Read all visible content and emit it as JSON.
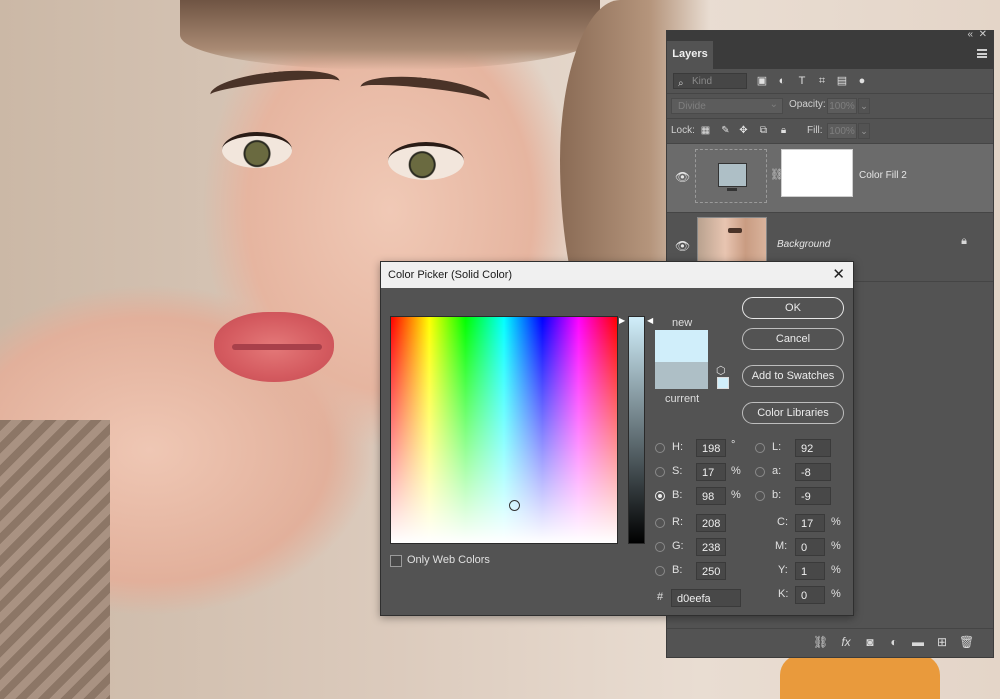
{
  "colors": {
    "new": "#d0eefa",
    "current": "#aebfc6",
    "panel": "#535353"
  },
  "layers_panel": {
    "tab": "Layers",
    "filter_placeholder": "Kind",
    "blend_mode": "Divide",
    "opacity_label": "Opacity:",
    "opacity_value": "100%",
    "lock_label": "Lock:",
    "fill_label": "Fill:",
    "fill_value": "100%",
    "layers": [
      {
        "name": "Color Fill 2",
        "selected": true
      },
      {
        "name": "Background",
        "selected": false
      }
    ]
  },
  "color_picker": {
    "title": "Color Picker (Solid Color)",
    "new_label": "new",
    "current_label": "current",
    "only_web_colors": "Only Web Colors",
    "buttons": {
      "ok": "OK",
      "cancel": "Cancel",
      "add_to_swatches": "Add to Swatches",
      "color_libraries": "Color Libraries"
    },
    "fields": {
      "H": {
        "label": "H:",
        "value": "198",
        "unit": "°"
      },
      "S": {
        "label": "S:",
        "value": "17",
        "unit": "%"
      },
      "B": {
        "label": "B:",
        "value": "98",
        "unit": "%"
      },
      "R": {
        "label": "R:",
        "value": "208"
      },
      "G": {
        "label": "G:",
        "value": "238"
      },
      "Bl": {
        "label": "B:",
        "value": "250"
      },
      "L": {
        "label": "L:",
        "value": "92"
      },
      "a": {
        "label": "a:",
        "value": "-8"
      },
      "b": {
        "label": "b:",
        "value": "-9"
      },
      "C": {
        "label": "C:",
        "value": "17",
        "unit": "%"
      },
      "M": {
        "label": "M:",
        "value": "0",
        "unit": "%"
      },
      "Y": {
        "label": "Y:",
        "value": "1",
        "unit": "%"
      },
      "K": {
        "label": "K:",
        "value": "0",
        "unit": "%"
      }
    },
    "hex_label": "#",
    "hex_value": "d0eefa"
  }
}
